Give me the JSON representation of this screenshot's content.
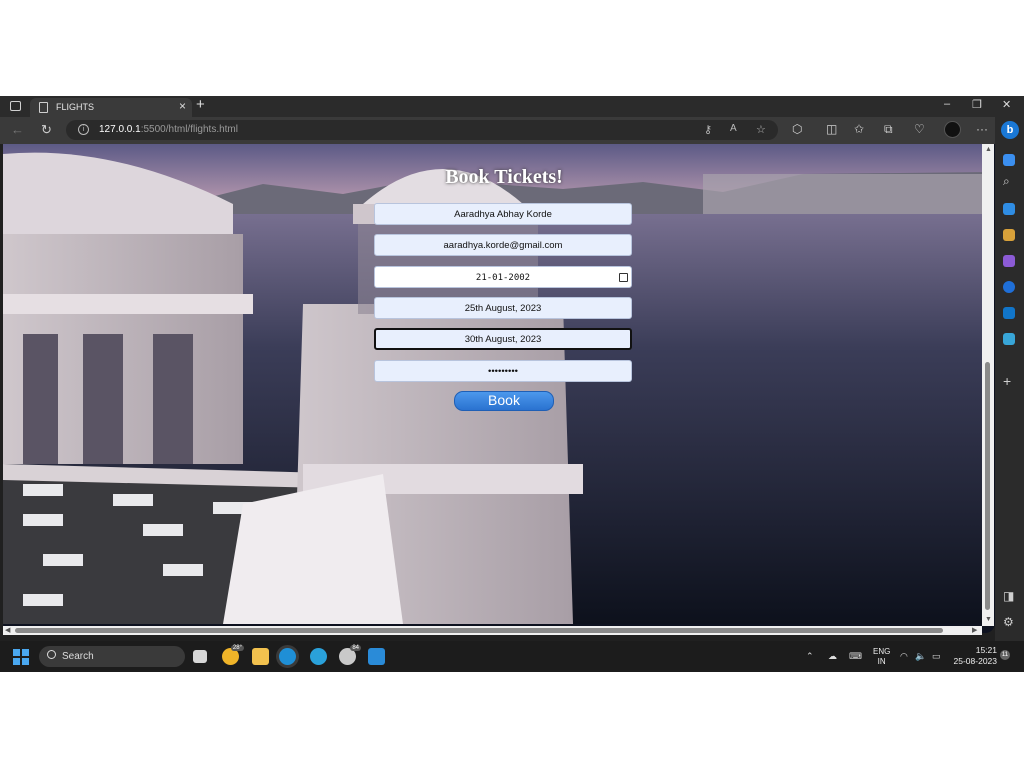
{
  "browser": {
    "tab_title": "FLIGHTS",
    "tab_close": "×",
    "new_tab": "+",
    "url_host": "127.0.0.1",
    "url_rest": ":5500/html/flights.html",
    "window_controls": [
      "–",
      "❐",
      "✕"
    ],
    "sidebar_logo": "b"
  },
  "page": {
    "heading": "Book Tickets!",
    "fields": {
      "name": "Aaradhya Abhay Korde",
      "email": "aaradhya.korde@gmail.com",
      "dob": "21-01-2002",
      "departure": "25th August, 2023",
      "return": "30th August, 2023",
      "password": "•••••••••"
    },
    "book_label": "Book"
  },
  "taskbar": {
    "search_label": "Search",
    "weather_temp": "28°",
    "whatsapp_badge": "84",
    "lang_top": "ENG",
    "lang_bottom": "IN",
    "time": "15:21",
    "date": "25-08-2023",
    "notifications": "11"
  },
  "colors": {
    "accent": "#1a78d6",
    "button": "#2a72d0",
    "field_bg": "#e8effd"
  }
}
